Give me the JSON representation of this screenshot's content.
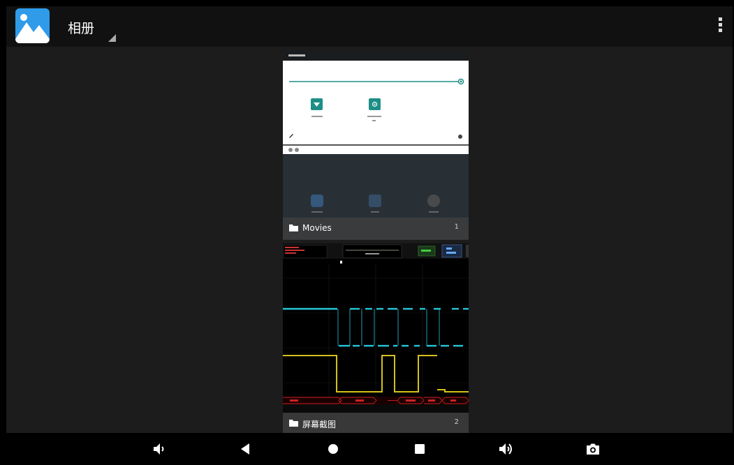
{
  "app": {
    "title": "相册",
    "icon": "gallery-icon"
  },
  "appbar": {
    "menu_icon": "overflow-menu-icon"
  },
  "albums": [
    {
      "name": "Movies",
      "count": "1",
      "icon": "folder-icon"
    },
    {
      "name": "屏幕截图",
      "count": "2",
      "icon": "folder-icon"
    }
  ],
  "navbar": {
    "buttons": [
      "volume-down-icon",
      "back-icon",
      "home-icon",
      "recents-icon",
      "volume-up-icon",
      "camera-icon"
    ]
  },
  "colors": {
    "accent": "#2f9be9",
    "appbar_bg": "#111111",
    "screen_bg": "#1c1c1c",
    "trace_cyan": "#26c6da",
    "trace_yellow": "#d6c11a",
    "teal": "#1e8f86"
  }
}
